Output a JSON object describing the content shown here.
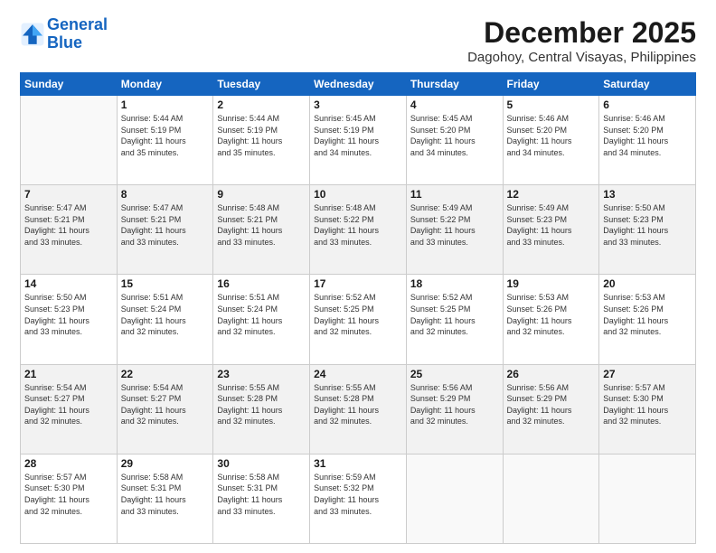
{
  "logo": {
    "line1": "General",
    "line2": "Blue"
  },
  "title": "December 2025",
  "location": "Dagohoy, Central Visayas, Philippines",
  "days_header": [
    "Sunday",
    "Monday",
    "Tuesday",
    "Wednesday",
    "Thursday",
    "Friday",
    "Saturday"
  ],
  "weeks": [
    [
      {
        "num": "",
        "info": ""
      },
      {
        "num": "1",
        "info": "Sunrise: 5:44 AM\nSunset: 5:19 PM\nDaylight: 11 hours\nand 35 minutes."
      },
      {
        "num": "2",
        "info": "Sunrise: 5:44 AM\nSunset: 5:19 PM\nDaylight: 11 hours\nand 35 minutes."
      },
      {
        "num": "3",
        "info": "Sunrise: 5:45 AM\nSunset: 5:19 PM\nDaylight: 11 hours\nand 34 minutes."
      },
      {
        "num": "4",
        "info": "Sunrise: 5:45 AM\nSunset: 5:20 PM\nDaylight: 11 hours\nand 34 minutes."
      },
      {
        "num": "5",
        "info": "Sunrise: 5:46 AM\nSunset: 5:20 PM\nDaylight: 11 hours\nand 34 minutes."
      },
      {
        "num": "6",
        "info": "Sunrise: 5:46 AM\nSunset: 5:20 PM\nDaylight: 11 hours\nand 34 minutes."
      }
    ],
    [
      {
        "num": "7",
        "info": "Sunrise: 5:47 AM\nSunset: 5:21 PM\nDaylight: 11 hours\nand 33 minutes."
      },
      {
        "num": "8",
        "info": "Sunrise: 5:47 AM\nSunset: 5:21 PM\nDaylight: 11 hours\nand 33 minutes."
      },
      {
        "num": "9",
        "info": "Sunrise: 5:48 AM\nSunset: 5:21 PM\nDaylight: 11 hours\nand 33 minutes."
      },
      {
        "num": "10",
        "info": "Sunrise: 5:48 AM\nSunset: 5:22 PM\nDaylight: 11 hours\nand 33 minutes."
      },
      {
        "num": "11",
        "info": "Sunrise: 5:49 AM\nSunset: 5:22 PM\nDaylight: 11 hours\nand 33 minutes."
      },
      {
        "num": "12",
        "info": "Sunrise: 5:49 AM\nSunset: 5:23 PM\nDaylight: 11 hours\nand 33 minutes."
      },
      {
        "num": "13",
        "info": "Sunrise: 5:50 AM\nSunset: 5:23 PM\nDaylight: 11 hours\nand 33 minutes."
      }
    ],
    [
      {
        "num": "14",
        "info": "Sunrise: 5:50 AM\nSunset: 5:23 PM\nDaylight: 11 hours\nand 33 minutes."
      },
      {
        "num": "15",
        "info": "Sunrise: 5:51 AM\nSunset: 5:24 PM\nDaylight: 11 hours\nand 32 minutes."
      },
      {
        "num": "16",
        "info": "Sunrise: 5:51 AM\nSunset: 5:24 PM\nDaylight: 11 hours\nand 32 minutes."
      },
      {
        "num": "17",
        "info": "Sunrise: 5:52 AM\nSunset: 5:25 PM\nDaylight: 11 hours\nand 32 minutes."
      },
      {
        "num": "18",
        "info": "Sunrise: 5:52 AM\nSunset: 5:25 PM\nDaylight: 11 hours\nand 32 minutes."
      },
      {
        "num": "19",
        "info": "Sunrise: 5:53 AM\nSunset: 5:26 PM\nDaylight: 11 hours\nand 32 minutes."
      },
      {
        "num": "20",
        "info": "Sunrise: 5:53 AM\nSunset: 5:26 PM\nDaylight: 11 hours\nand 32 minutes."
      }
    ],
    [
      {
        "num": "21",
        "info": "Sunrise: 5:54 AM\nSunset: 5:27 PM\nDaylight: 11 hours\nand 32 minutes."
      },
      {
        "num": "22",
        "info": "Sunrise: 5:54 AM\nSunset: 5:27 PM\nDaylight: 11 hours\nand 32 minutes."
      },
      {
        "num": "23",
        "info": "Sunrise: 5:55 AM\nSunset: 5:28 PM\nDaylight: 11 hours\nand 32 minutes."
      },
      {
        "num": "24",
        "info": "Sunrise: 5:55 AM\nSunset: 5:28 PM\nDaylight: 11 hours\nand 32 minutes."
      },
      {
        "num": "25",
        "info": "Sunrise: 5:56 AM\nSunset: 5:29 PM\nDaylight: 11 hours\nand 32 minutes."
      },
      {
        "num": "26",
        "info": "Sunrise: 5:56 AM\nSunset: 5:29 PM\nDaylight: 11 hours\nand 32 minutes."
      },
      {
        "num": "27",
        "info": "Sunrise: 5:57 AM\nSunset: 5:30 PM\nDaylight: 11 hours\nand 32 minutes."
      }
    ],
    [
      {
        "num": "28",
        "info": "Sunrise: 5:57 AM\nSunset: 5:30 PM\nDaylight: 11 hours\nand 32 minutes."
      },
      {
        "num": "29",
        "info": "Sunrise: 5:58 AM\nSunset: 5:31 PM\nDaylight: 11 hours\nand 33 minutes."
      },
      {
        "num": "30",
        "info": "Sunrise: 5:58 AM\nSunset: 5:31 PM\nDaylight: 11 hours\nand 33 minutes."
      },
      {
        "num": "31",
        "info": "Sunrise: 5:59 AM\nSunset: 5:32 PM\nDaylight: 11 hours\nand 33 minutes."
      },
      {
        "num": "",
        "info": ""
      },
      {
        "num": "",
        "info": ""
      },
      {
        "num": "",
        "info": ""
      }
    ]
  ]
}
